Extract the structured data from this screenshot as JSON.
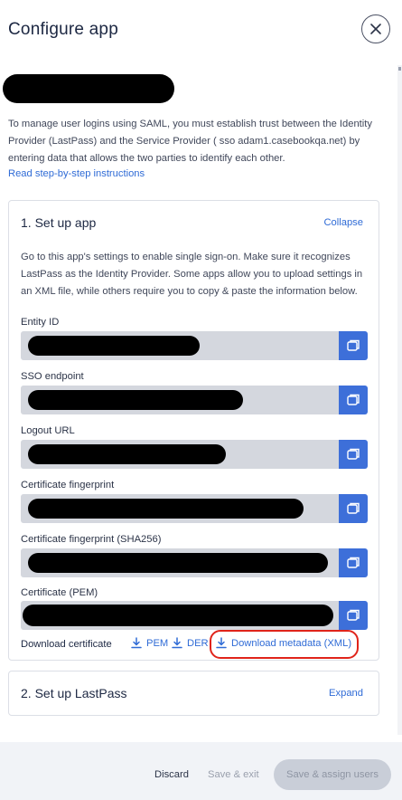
{
  "header": {
    "title": "Configure app",
    "close_icon": "close-icon"
  },
  "intro": {
    "text": "To manage user logins using SAML, you must establish trust between the Identity Provider (LastPass) and the Service Provider ( sso adam1.casebookqa.net) by entering data that allows the two parties to identify each other.",
    "instructions_link": "Read step-by-step instructions"
  },
  "setup_app": {
    "title": "1. Set up app",
    "collapse_label": "Collapse",
    "description": "Go to this app's settings to enable single sign-on. Make sure it recognizes LastPass as the Identity Provider. Some apps allow you to upload settings in an XML file, while others require you to copy & paste the information below.",
    "fields": [
      {
        "label": "Entity ID"
      },
      {
        "label": "SSO endpoint"
      },
      {
        "label": "Logout URL"
      },
      {
        "label": "Certificate fingerprint"
      },
      {
        "label": "Certificate fingerprint (SHA256)"
      },
      {
        "label": "Certificate (PEM)"
      }
    ],
    "download": {
      "label": "Download certificate",
      "pem": "PEM",
      "der": "DER",
      "metadata": "Download metadata (XML)"
    }
  },
  "setup_lastpass": {
    "title": "2. Set up LastPass",
    "expand_label": "Expand"
  },
  "footer": {
    "discard": "Discard",
    "save_exit": "Save & exit",
    "save_assign": "Save & assign users"
  },
  "colors": {
    "accent": "#3d6fd9",
    "link": "#2f6bd6",
    "highlight": "#e0241a"
  }
}
